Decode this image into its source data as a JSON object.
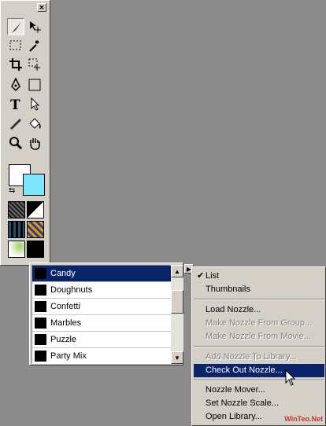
{
  "toolbox": {
    "close_glyph": "×",
    "tools": [
      {
        "name": "paintbrush-tool",
        "icon": "paintbrush-icon",
        "active": true
      },
      {
        "name": "move-tool",
        "icon": "move-icon"
      },
      {
        "name": "marquee-tool",
        "icon": "marquee-icon"
      },
      {
        "name": "magic-wand-tool",
        "icon": "magic-wand-icon"
      },
      {
        "name": "crop-tool",
        "icon": "crop-icon"
      },
      {
        "name": "lasso-tool",
        "icon": "lasso-icon"
      },
      {
        "name": "pen-tool",
        "icon": "pen-icon"
      },
      {
        "name": "rectangle-tool",
        "icon": "rectangle-icon"
      },
      {
        "name": "text-tool",
        "icon": "text-icon",
        "glyph": "T"
      },
      {
        "name": "arrow-select-tool",
        "icon": "arrow-icon"
      },
      {
        "name": "eyedropper-tool",
        "icon": "eyedropper-icon"
      },
      {
        "name": "fill-bucket-tool",
        "icon": "bucket-icon"
      },
      {
        "name": "zoom-tool",
        "icon": "magnifier-icon"
      },
      {
        "name": "hand-tool",
        "icon": "hand-icon"
      }
    ],
    "colors": {
      "background": "#ffffff",
      "foreground": "#7fe6ff"
    },
    "swap_glyph": "⇆"
  },
  "nozzle_list": {
    "items": [
      {
        "label": "Candy",
        "selected": true
      },
      {
        "label": "Doughnuts"
      },
      {
        "label": "Confetti"
      },
      {
        "label": "Marbles"
      },
      {
        "label": "Puzzle"
      },
      {
        "label": "Party Mix"
      }
    ],
    "scroll_up": "▲",
    "scroll_down": "▼",
    "flyout_arrow": "▶"
  },
  "menu": {
    "check_glyph": "✔",
    "items": [
      {
        "label": "List",
        "checked": true
      },
      {
        "label": "Thumbnails"
      },
      {
        "label": "Load Nozzle..."
      },
      {
        "label": "Make Nozzle From Group...",
        "disabled": true
      },
      {
        "label": "Make Nozzle From Movie...",
        "disabled": true
      },
      {
        "label": "Add Nozzle To Library...",
        "disabled": true
      },
      {
        "label": "Check Out Nozzle...",
        "hover": true
      },
      {
        "label": "Nozzle Mover..."
      },
      {
        "label": "Set Nozzle Scale..."
      },
      {
        "label": "Open Library..."
      }
    ]
  },
  "watermark": "WinTeo.Net",
  "accent_color": "#0a246a"
}
